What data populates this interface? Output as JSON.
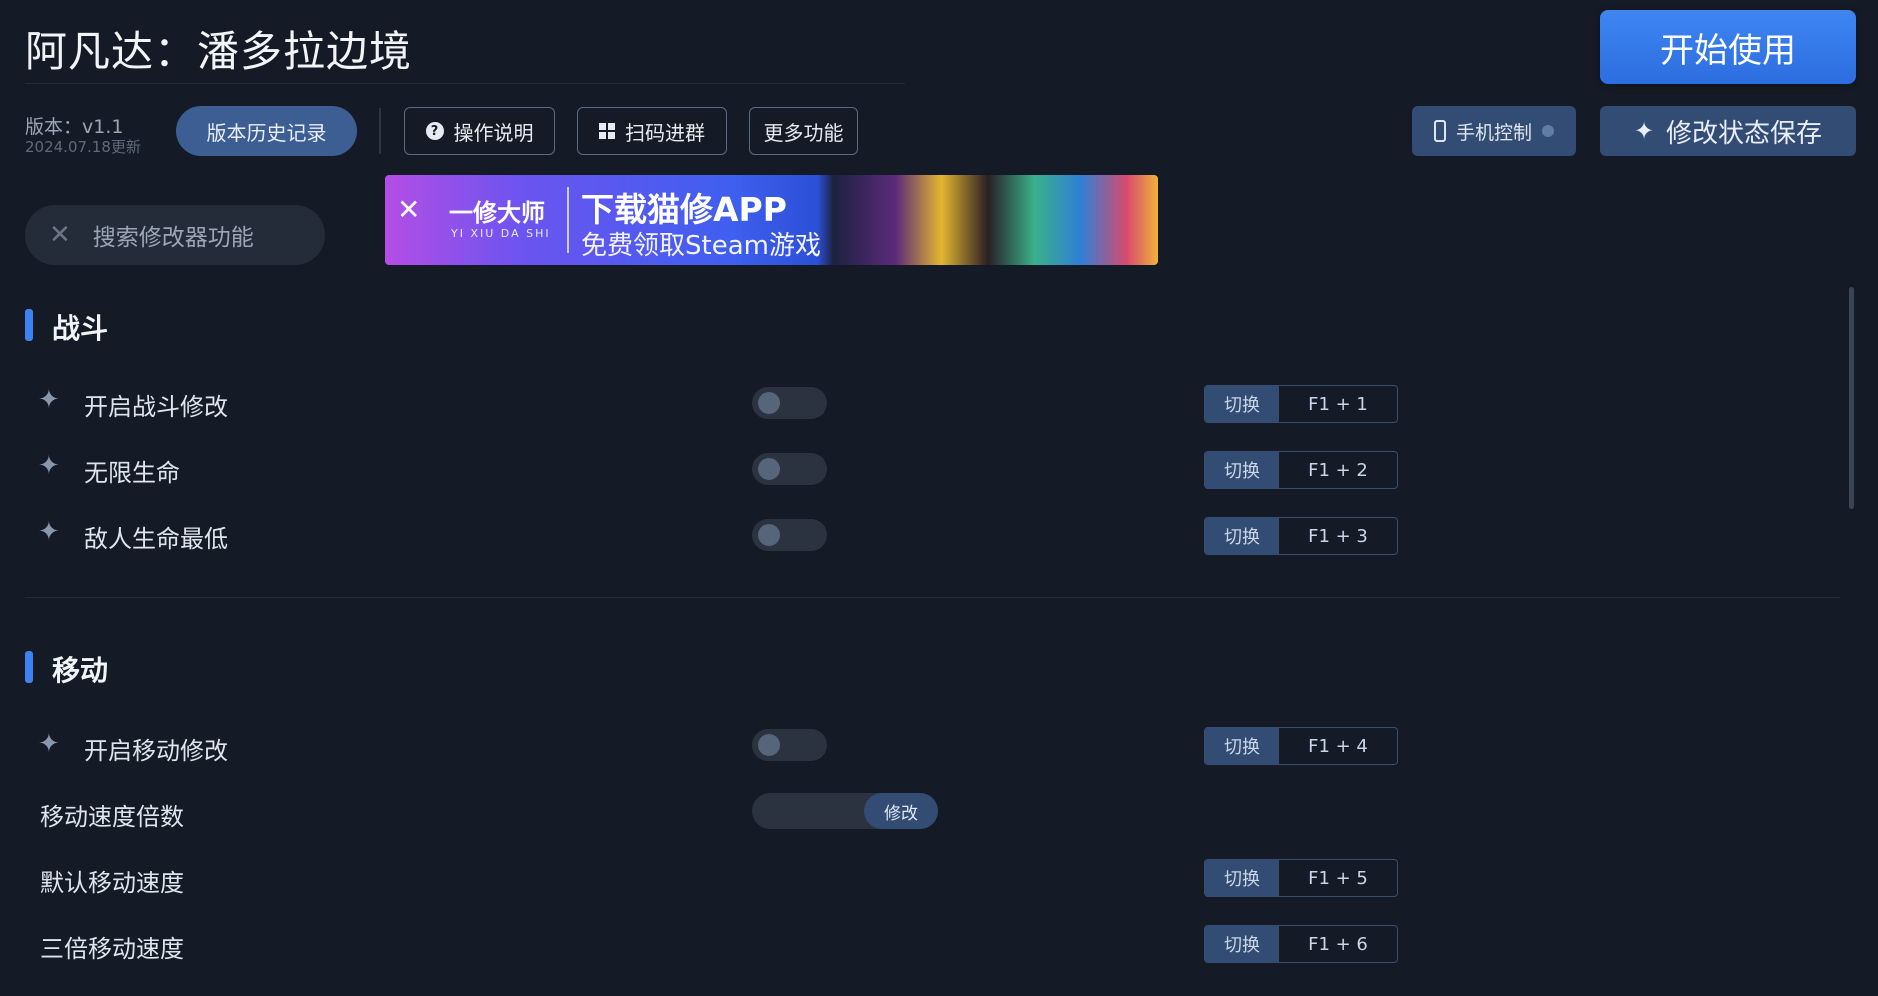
{
  "header": {
    "title": "阿凡达：潘多拉边境",
    "start_button": "开始使用",
    "version": "版本：v1.1",
    "version_date": "2024.07.18更新",
    "history_button": "版本历史记录",
    "help_button": "操作说明",
    "qr_button": "扫码进群",
    "more_button": "更多功能",
    "phone_button": "手机控制",
    "save_button": "修改状态保存"
  },
  "search": {
    "placeholder": "搜索修改器功能"
  },
  "banner": {
    "brand": "一修大师",
    "brand_sub": "YI XIU DA SHI",
    "line1": "下载猫修APP",
    "line2": "免费领取Steam游戏"
  },
  "sections": [
    {
      "title": "战斗",
      "items": [
        {
          "label": "开启战斗修改",
          "toggle": "off",
          "hotkey_action": "切换",
          "hotkey": "F1 + 1"
        },
        {
          "label": "无限生命",
          "toggle": "off",
          "hotkey_action": "切换",
          "hotkey": "F1 + 2"
        },
        {
          "label": "敌人生命最低",
          "toggle": "off",
          "hotkey_action": "切换",
          "hotkey": "F1 + 3"
        }
      ]
    },
    {
      "title": "移动",
      "items": [
        {
          "label": "开启移动修改",
          "toggle": "off",
          "hotkey_action": "切换",
          "hotkey": "F1 + 4"
        },
        {
          "label": "移动速度倍数",
          "modify_button": "修改"
        },
        {
          "label": "默认移动速度",
          "hotkey_action": "切换",
          "hotkey": "F1 + 5"
        },
        {
          "label": "三倍移动速度",
          "hotkey_action": "切换",
          "hotkey": "F1 + 6"
        }
      ]
    }
  ],
  "colors": {
    "background": "#151b26",
    "accent": "#3b83f0",
    "button_fill": "#334c74"
  }
}
